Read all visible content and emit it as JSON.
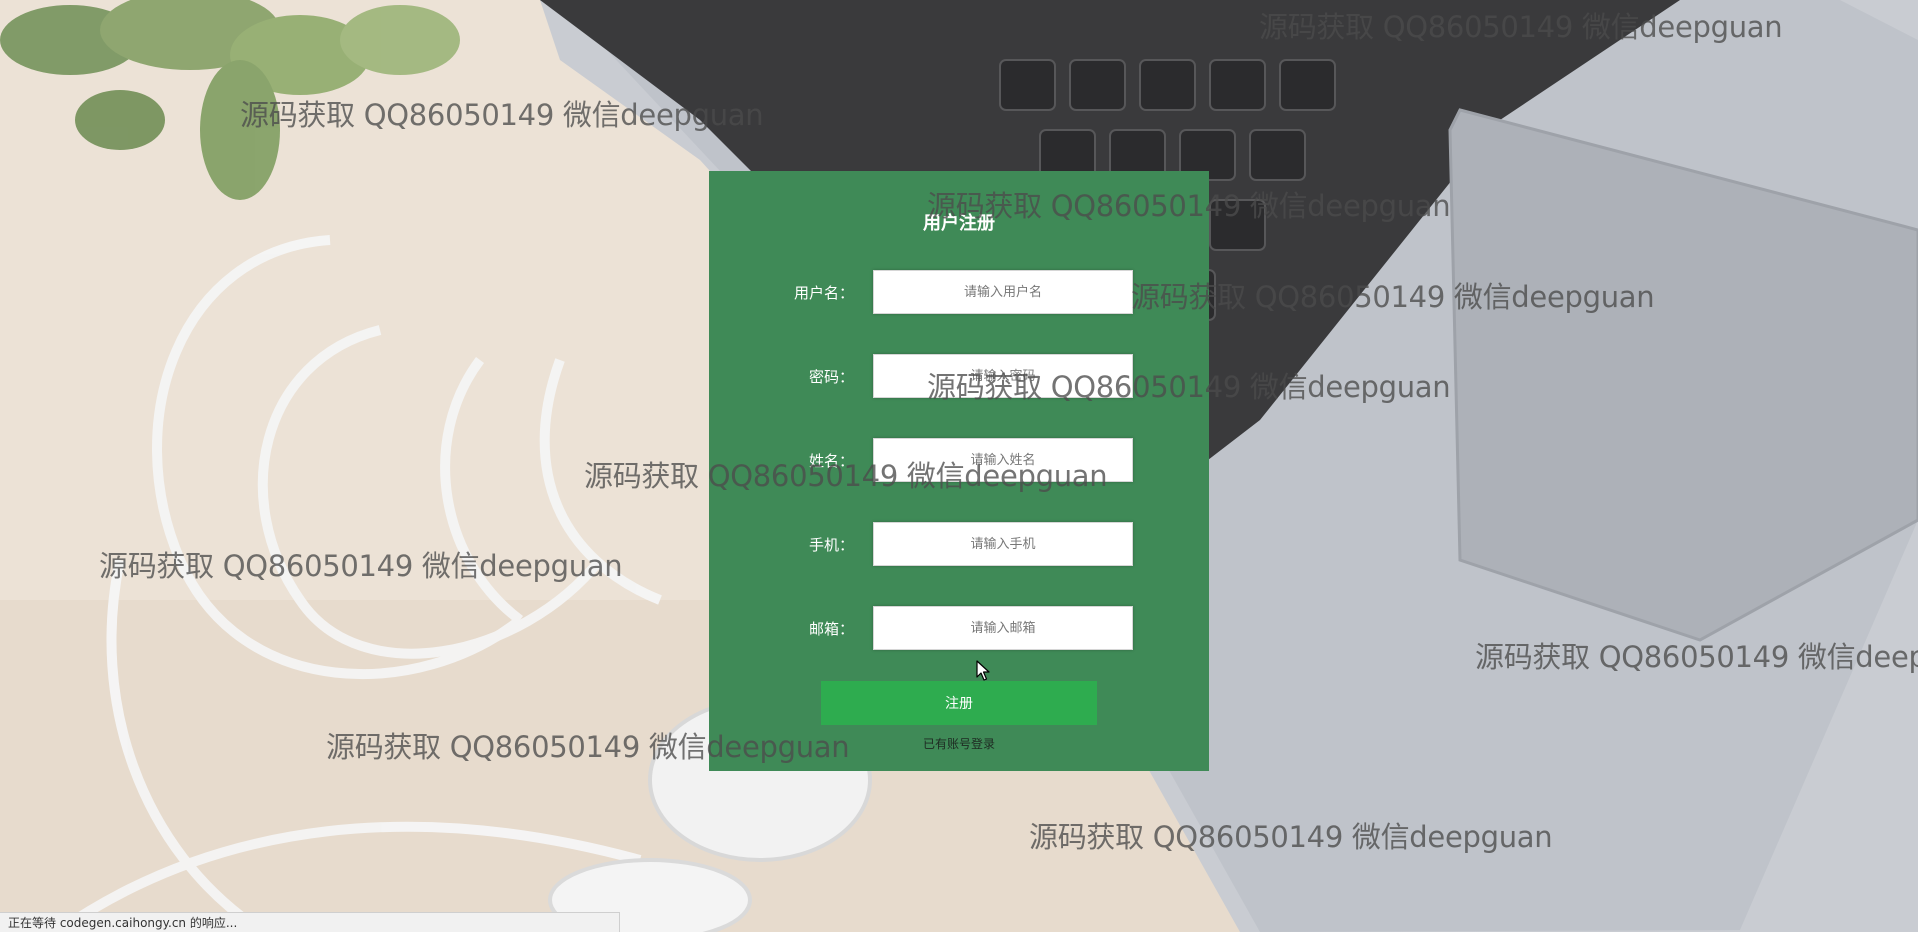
{
  "form": {
    "title": "用户注册",
    "fields": [
      {
        "label": "用户名：",
        "placeholder": "请输入用户名",
        "value": ""
      },
      {
        "label": "密码：",
        "placeholder": "请输入密码",
        "value": ""
      },
      {
        "label": "姓名：",
        "placeholder": "请输入姓名",
        "value": ""
      },
      {
        "label": "手机：",
        "placeholder": "请输入手机",
        "value": ""
      },
      {
        "label": "邮箱：",
        "placeholder": "请输入邮箱",
        "value": ""
      }
    ],
    "submit_label": "注册",
    "login_link": "已有账号登录"
  },
  "watermark_text": "源码获取 QQ86050149 微信deepguan",
  "status_bar": "正在等待 codegen.caihongy.cn 的响应...",
  "colors": {
    "card_bg": "#3f8a57",
    "submit_bg": "#2eac4f"
  }
}
